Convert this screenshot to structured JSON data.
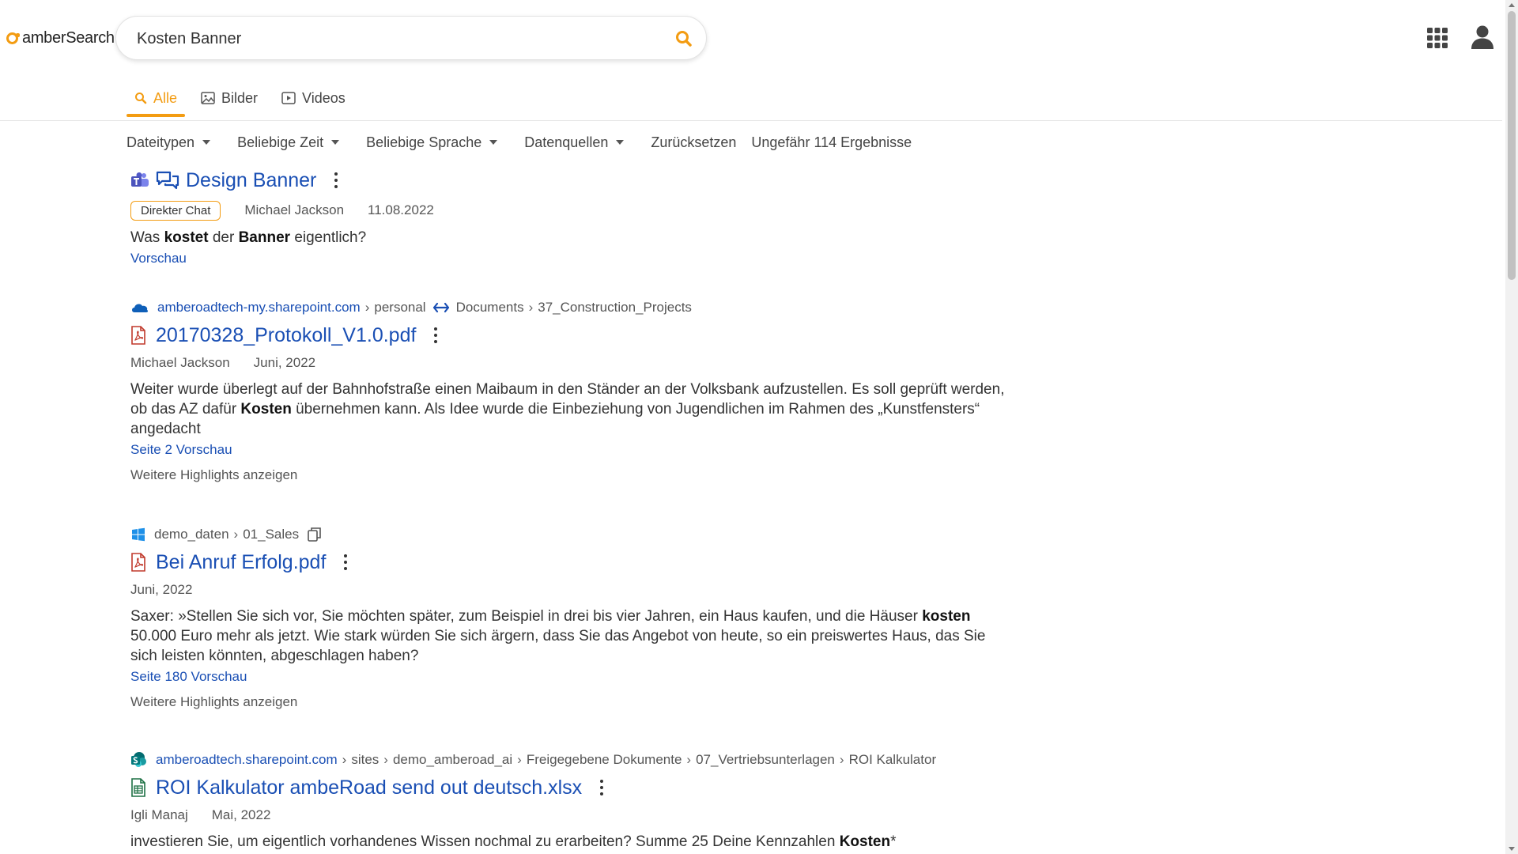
{
  "header": {
    "logo_text": "amberSearch",
    "search_value": "Kosten Banner",
    "icons": {
      "search": "search-icon",
      "apps": "apps-grid-icon",
      "user": "user-icon"
    },
    "accent_color": "#f39c12"
  },
  "tabs": [
    {
      "label": "Alle",
      "icon": "search-icon",
      "active": true
    },
    {
      "label": "Bilder",
      "icon": "image-icon"
    },
    {
      "label": "Videos",
      "icon": "video-icon"
    }
  ],
  "filters": {
    "items": [
      "Dateitypen",
      "Beliebige Zeit",
      "Beliebige Sprache",
      "Datenquellen"
    ],
    "reset_label": "Zurücksetzen",
    "result_count": "Ungefähr 114 Ergebnisse"
  },
  "results": [
    {
      "type": "chat",
      "source_icon": "teams-icon",
      "title_icon": "chat-icon",
      "title": "Design Banner",
      "badge": "Direkter Chat",
      "author": "Michael Jackson",
      "date": "11.08.2022",
      "snippet": [
        "Was ",
        "kostet",
        " der ",
        "Banner",
        " eigentlich?"
      ],
      "preview": "Vorschau"
    },
    {
      "type": "pdf",
      "source_icon": "onedrive-icon",
      "path": [
        "amberoadtech-my.sharepoint.com",
        "personal",
        "Documents",
        "37_Construction_Projects"
      ],
      "title": "20170328_Protokoll_V1.0.pdf",
      "author": "Michael Jackson",
      "date": "Juni, 2022",
      "snippet": [
        "Weiter wurde überlegt auf der Bahnhofstraße einen Maibaum in den Ständer an der Volksbank aufzustellen. Es soll geprüft werden, ob das AZ dafür ",
        "Kosten",
        " übernehmen kann. Als Idee wurde die Einbeziehung von Jugendlichen im Rahmen des „Kunstfensters“ angedacht"
      ],
      "preview": "Seite 2 Vorschau",
      "more": "Weitere Highlights anzeigen"
    },
    {
      "type": "pdf",
      "source_icon": "windows-icon",
      "path": [
        "demo_daten",
        "01_Sales"
      ],
      "title": "Bei Anruf Erfolg.pdf",
      "date": "Juni, 2022",
      "snippet": [
        "Saxer: »Stellen Sie sich vor, Sie möchten später, zum Beispiel in drei bis vier Jahren, ein Haus kaufen, und die Häuser ",
        "kosten",
        " 50.000 Euro mehr als jetzt. Wie stark würden Sie sich ärgern, dass Sie das Angebot von heute, so ein preiswertes Haus, das Sie sich leisten könnten, abgeschlagen haben?"
      ],
      "preview": "Seite 180 Vorschau",
      "more": "Weitere Highlights anzeigen"
    },
    {
      "type": "xlsx",
      "source_icon": "sharepoint-icon",
      "path": [
        "amberoadtech.sharepoint.com",
        "sites",
        "demo_amberoad_ai",
        "Freigegebene Dokumente",
        "07_Vertriebsunterlagen",
        "ROI Kalkulator"
      ],
      "title": "ROI Kalkulator ambeRoad send out deutsch.xlsx",
      "author": "Igli Manaj",
      "date": "Mai, 2022",
      "snippet": [
        "investieren Sie, um eigentlich vorhandenes Wissen nochmal zu erarbeiten? Summe 25 Deine Kennzahlen ",
        "Kosten",
        "*"
      ]
    }
  ]
}
